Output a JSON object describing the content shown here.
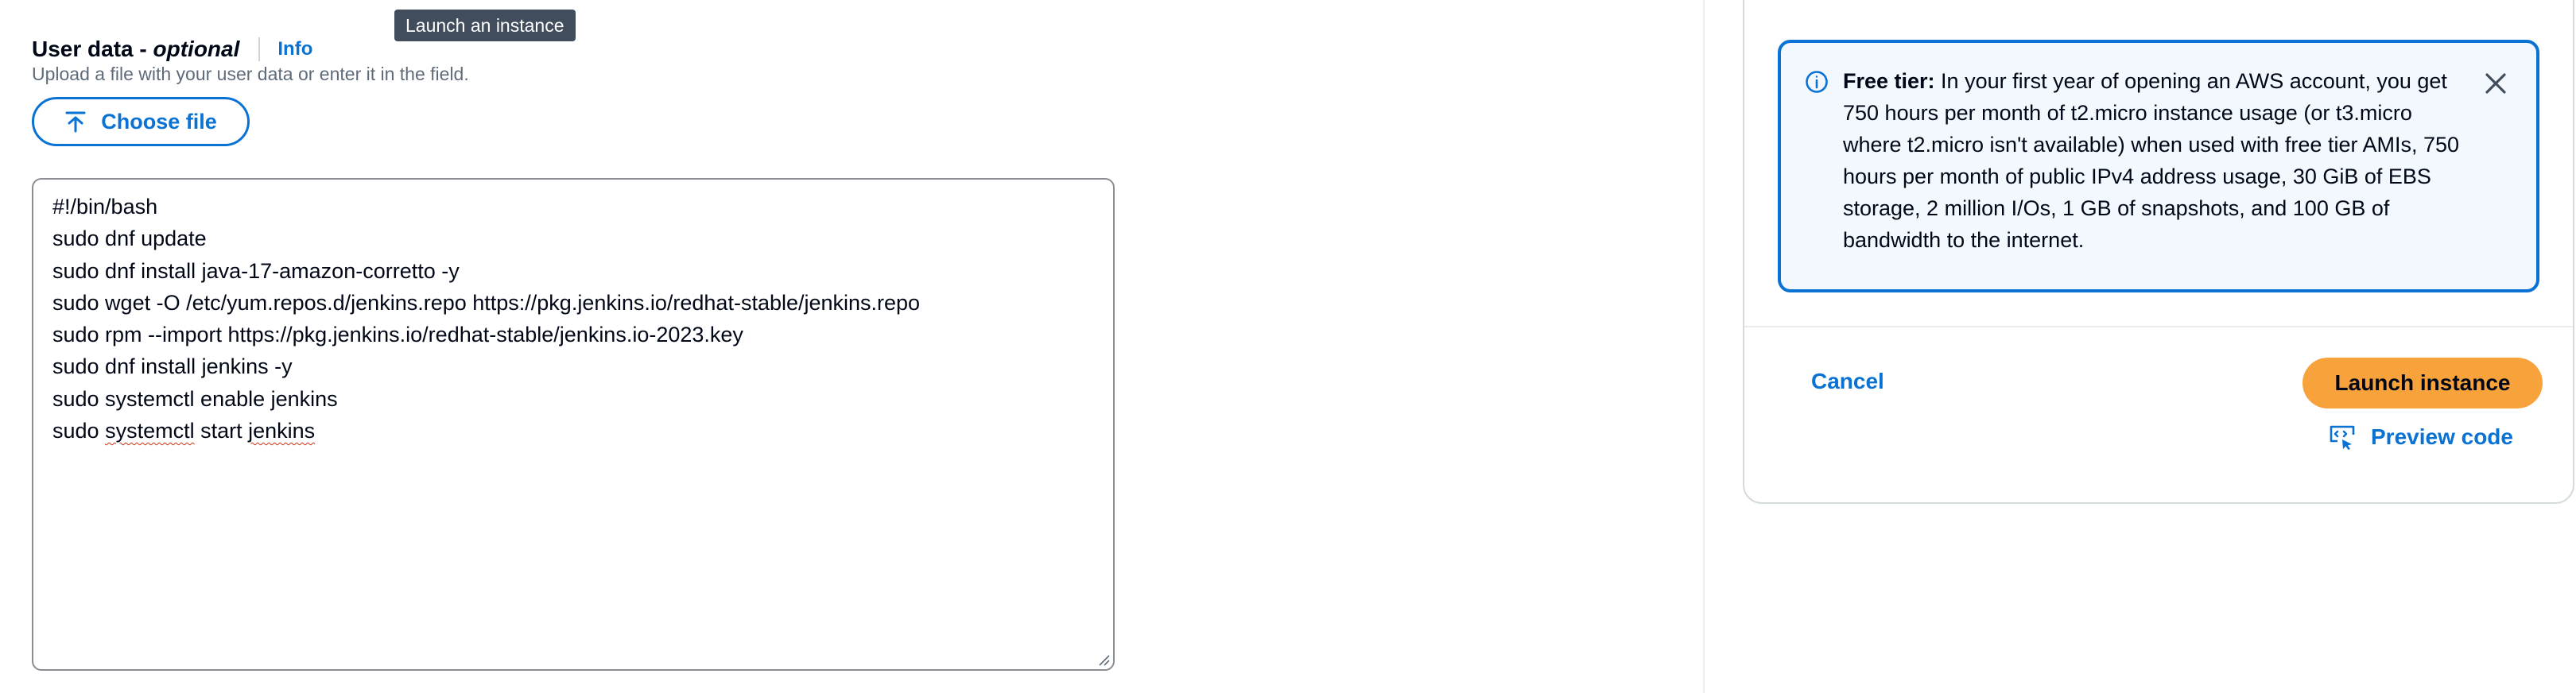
{
  "tooltip": {
    "text": "Launch an instance"
  },
  "user_data": {
    "label_main": "User data",
    "label_dash": " - ",
    "label_optional": "optional",
    "info_link": "Info",
    "description": "Upload a file with your user data or enter it in the field.",
    "choose_file_label": "Choose file",
    "script_lines": [
      "#!/bin/bash",
      "sudo dnf update",
      "sudo dnf install java-17-amazon-corretto -y",
      "sudo wget -O /etc/yum.repos.d/jenkins.repo https://pkg.jenkins.io/redhat-stable/jenkins.repo",
      "sudo rpm --import https://pkg.jenkins.io/redhat-stable/jenkins.io-2023.key",
      "sudo dnf install jenkins -y",
      "sudo systemctl enable jenkins",
      "sudo ",
      "systemctl",
      " start ",
      "jenkins"
    ]
  },
  "summary": {
    "free_tier": {
      "title": "Free tier:",
      "body": " In your first year of opening an AWS account, you get 750 hours per month of t2.micro instance usage (or t3.micro where t2.micro isn't available) when used with free tier AMIs, 750 hours per month of public IPv4 address usage, 30 GiB of EBS storage, 2 million I/Os, 1 GB of snapshots, and 100 GB of bandwidth to the internet."
    },
    "cancel_label": "Cancel",
    "launch_label": "Launch instance",
    "preview_code_label": "Preview code"
  },
  "colors": {
    "link_blue": "#0972d3",
    "primary_orange": "#f7a23b",
    "info_bg": "#f2f8fd",
    "tooltip_bg": "#414d5c"
  },
  "icons": [
    "upload-icon",
    "info-circle-icon",
    "close-icon",
    "preview-code-icon",
    "resize-grip-icon"
  ]
}
